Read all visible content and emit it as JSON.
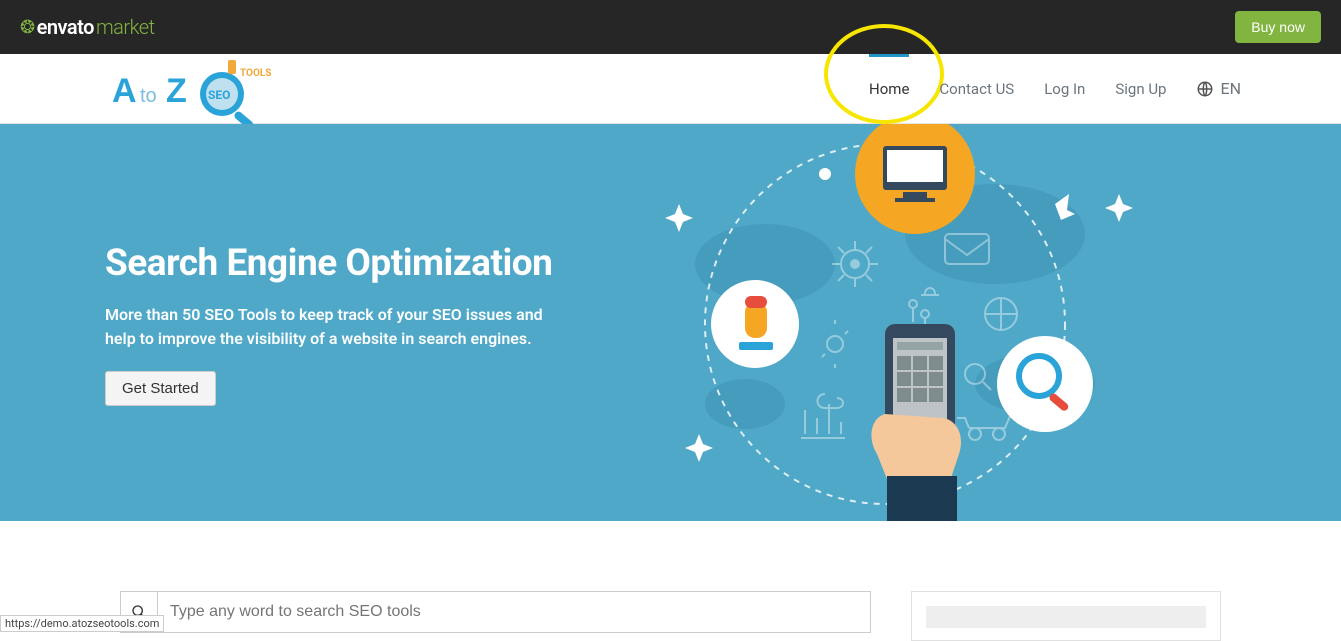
{
  "envato": {
    "brand1": "envato",
    "brand2": "market",
    "buy_now": "Buy now"
  },
  "logo": {
    "a": "A",
    "to": "to",
    "z": "Z",
    "seo": "SEO",
    "tools": "TOOLS"
  },
  "nav": {
    "home": "Home",
    "contact": "Contact US",
    "login": "Log In",
    "signup": "Sign Up",
    "lang": "EN"
  },
  "hero": {
    "title": "Search Engine Optimization",
    "desc": "More than 50 SEO Tools to keep track of your SEO issues and help to improve the visibility of a website in search engines.",
    "cta": "Get Started"
  },
  "search": {
    "placeholder": "Type any word to search SEO tools"
  },
  "status_url": "https://demo.atozseotools.com"
}
